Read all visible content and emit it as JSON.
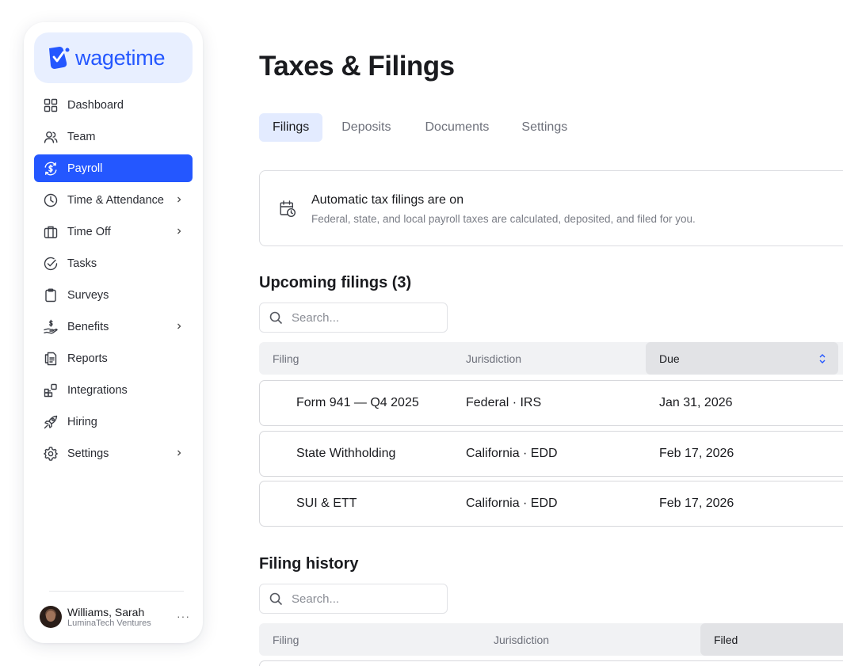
{
  "brand": {
    "name": "wagetime",
    "color": "#2457ff"
  },
  "sidebar": {
    "items": [
      {
        "label": "Dashboard",
        "icon": "grid-icon",
        "chevron": false,
        "active": false
      },
      {
        "label": "Team",
        "icon": "users-icon",
        "chevron": false,
        "active": false
      },
      {
        "label": "Payroll",
        "icon": "dollar-cycle-icon",
        "chevron": false,
        "active": true
      },
      {
        "label": "Time & Attendance",
        "icon": "clock-icon",
        "chevron": true,
        "active": false
      },
      {
        "label": "Time Off",
        "icon": "suitcase-icon",
        "chevron": true,
        "active": false
      },
      {
        "label": "Tasks",
        "icon": "check-circle-icon",
        "chevron": false,
        "active": false
      },
      {
        "label": "Surveys",
        "icon": "clipboard-icon",
        "chevron": false,
        "active": false
      },
      {
        "label": "Benefits",
        "icon": "hand-dollar-icon",
        "chevron": true,
        "active": false
      },
      {
        "label": "Reports",
        "icon": "document-icon",
        "chevron": false,
        "active": false
      },
      {
        "label": "Integrations",
        "icon": "blocks-icon",
        "chevron": false,
        "active": false
      },
      {
        "label": "Hiring",
        "icon": "rocket-icon",
        "chevron": false,
        "active": false
      },
      {
        "label": "Settings",
        "icon": "gear-icon",
        "chevron": true,
        "active": false
      }
    ],
    "user": {
      "name": "Williams, Sarah",
      "org": "LuminaTech Ventures",
      "more": "···"
    }
  },
  "main": {
    "title": "Taxes & Filings",
    "tabs": [
      {
        "label": "Filings",
        "active": true
      },
      {
        "label": "Deposits",
        "active": false
      },
      {
        "label": "Documents",
        "active": false
      },
      {
        "label": "Settings",
        "active": false
      }
    ],
    "banner": {
      "title": "Automatic tax filings are on",
      "subtitle": "Federal, state, and local payroll taxes are calculated, deposited, and filed for you."
    },
    "upcoming": {
      "title": "Upcoming filings (3)",
      "search_placeholder": "Search...",
      "columns": [
        "Filing",
        "Jurisdiction",
        "Due"
      ],
      "rows": [
        {
          "filing": "Form 941 — Q4 2025",
          "jurisdiction": "Federal · IRS",
          "due": "Jan 31, 2026"
        },
        {
          "filing": "State Withholding",
          "jurisdiction": "California · EDD",
          "due": "Feb 17, 2026"
        },
        {
          "filing": "SUI & ETT",
          "jurisdiction": "California · EDD",
          "due": "Feb 17, 2026"
        }
      ]
    },
    "history": {
      "title": "Filing history",
      "search_placeholder": "Search...",
      "columns": [
        "Filing",
        "Jurisdiction",
        "Filed"
      ]
    }
  }
}
